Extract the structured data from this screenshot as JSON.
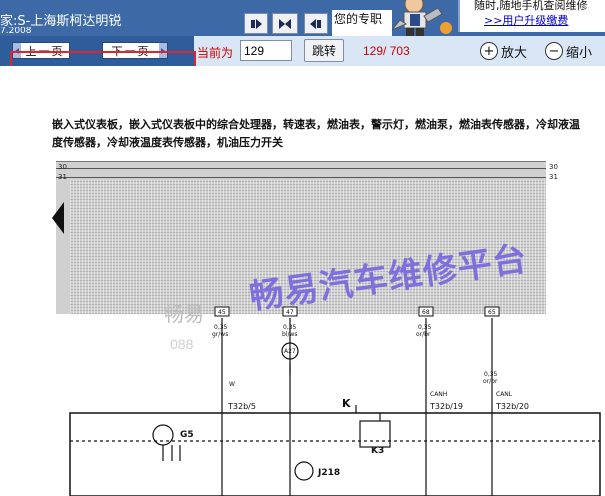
{
  "window": {
    "title": "家:S-上海斯柯达明锐",
    "subtitle": "7.2008",
    "expert_label": "您的专职",
    "promo_line1": "随时,随地手机查阅维修",
    "promo_line2": ">>用户升级缴费"
  },
  "toolbar": {
    "prev_label": "上一页",
    "next_label": "下一页",
    "current_label": "当前为",
    "page_value": "129",
    "jump_label": "跳转",
    "page_count": "129/ 703",
    "zoom_in_label": "放大",
    "zoom_out_label": "缩小"
  },
  "document": {
    "caption": "嵌入式仪表板，嵌入式仪表板中的综合处理器，转速表，燃油表，警示灯，燃油泵，燃油表传感器，冷却液温度传感器，冷却液温度表传感器，机油压力开关",
    "row_labels": [
      "30",
      "31"
    ],
    "wire_numbers": [
      "45",
      "47",
      "68",
      "65"
    ],
    "wire_specs": [
      {
        "size": "0,35",
        "color": "gr/ws"
      },
      {
        "size": "0,35",
        "color": "bl/ws"
      },
      {
        "size": "0,35",
        "color": "or/br"
      },
      {
        "size": "0,35",
        "color": "or/br"
      }
    ],
    "connector_labels": [
      "T32b/5",
      "T32b/19",
      "T32b/20"
    ],
    "signal_labels": [
      "W",
      "CANH",
      "CANL"
    ],
    "component_labels": [
      "A27",
      "G5",
      "K",
      "K3",
      "J218"
    ],
    "watermark": "畅易汽车维修平台",
    "faint_watermark": "畅易",
    "faint_number": "088"
  },
  "colors": {
    "topbar": "#3d6aa6",
    "nav_area": "#2f5d9c",
    "toolbar": "#d9e6f6",
    "highlight": "#e0262a",
    "red_text": "#cc0000",
    "watermark": "#6d5be0"
  }
}
